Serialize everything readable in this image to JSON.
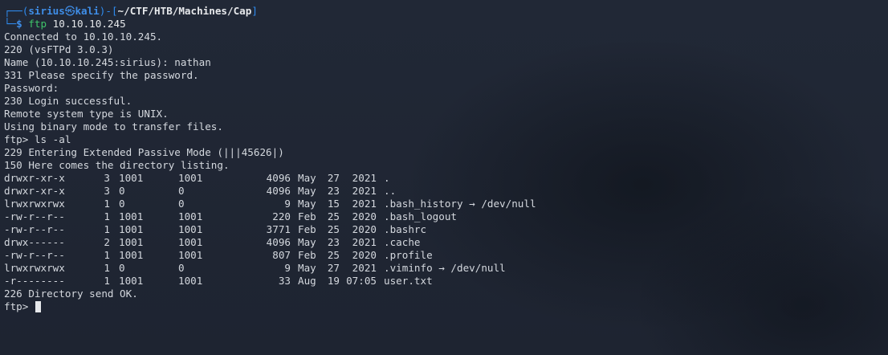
{
  "prompt": {
    "frame_top": "┌──(",
    "user": "sirius",
    "at_symbol": "㉿",
    "host": "kali",
    "frame_mid": ")-[",
    "path": "~/CTF/HTB/Machines/Cap",
    "frame_end": "]",
    "frame_bottom": "└─",
    "dollar": "$ ",
    "command": "ftp",
    "command_args": " 10.10.10.245"
  },
  "output_before": [
    "Connected to 10.10.10.245.",
    "220 (vsFTPd 3.0.3)",
    "Name (10.10.10.245:sirius): nathan",
    "331 Please specify the password.",
    "Password:",
    "230 Login successful.",
    "Remote system type is UNIX.",
    "Using binary mode to transfer files.",
    "ftp> ls -al",
    "229 Entering Extended Passive Mode (|||45626|)",
    "150 Here comes the directory listing."
  ],
  "listing": [
    {
      "perm": "drwxr-xr-x",
      "links": "3",
      "owner": "1001",
      "group": "1001",
      "size": "4096",
      "month": "May",
      "day": "27",
      "time": "2021",
      "name": "."
    },
    {
      "perm": "drwxr-xr-x",
      "links": "3",
      "owner": "0",
      "group": "0",
      "size": "4096",
      "month": "May",
      "day": "23",
      "time": "2021",
      "name": ".."
    },
    {
      "perm": "lrwxrwxrwx",
      "links": "1",
      "owner": "0",
      "group": "0",
      "size": "9",
      "month": "May",
      "day": "15",
      "time": "2021",
      "name": ".bash_history → /dev/null"
    },
    {
      "perm": "-rw-r--r--",
      "links": "1",
      "owner": "1001",
      "group": "1001",
      "size": "220",
      "month": "Feb",
      "day": "25",
      "time": "2020",
      "name": ".bash_logout"
    },
    {
      "perm": "-rw-r--r--",
      "links": "1",
      "owner": "1001",
      "group": "1001",
      "size": "3771",
      "month": "Feb",
      "day": "25",
      "time": "2020",
      "name": ".bashrc"
    },
    {
      "perm": "drwx------",
      "links": "2",
      "owner": "1001",
      "group": "1001",
      "size": "4096",
      "month": "May",
      "day": "23",
      "time": "2021",
      "name": ".cache"
    },
    {
      "perm": "-rw-r--r--",
      "links": "1",
      "owner": "1001",
      "group": "1001",
      "size": "807",
      "month": "Feb",
      "day": "25",
      "time": "2020",
      "name": ".profile"
    },
    {
      "perm": "lrwxrwxrwx",
      "links": "1",
      "owner": "0",
      "group": "0",
      "size": "9",
      "month": "May",
      "day": "27",
      "time": "2021",
      "name": ".viminfo → /dev/null"
    },
    {
      "perm": "-r--------",
      "links": "1",
      "owner": "1001",
      "group": "1001",
      "size": "33",
      "month": "Aug",
      "day": "19",
      "time": "07:05",
      "name": "user.txt"
    }
  ],
  "output_after": [
    "226 Directory send OK."
  ],
  "final_prompt": "ftp> ",
  "colors": {
    "background": "#1f2530",
    "text": "#d4d8de",
    "prompt_blue": "#3f8ee8",
    "command_green": "#3fc56a"
  }
}
